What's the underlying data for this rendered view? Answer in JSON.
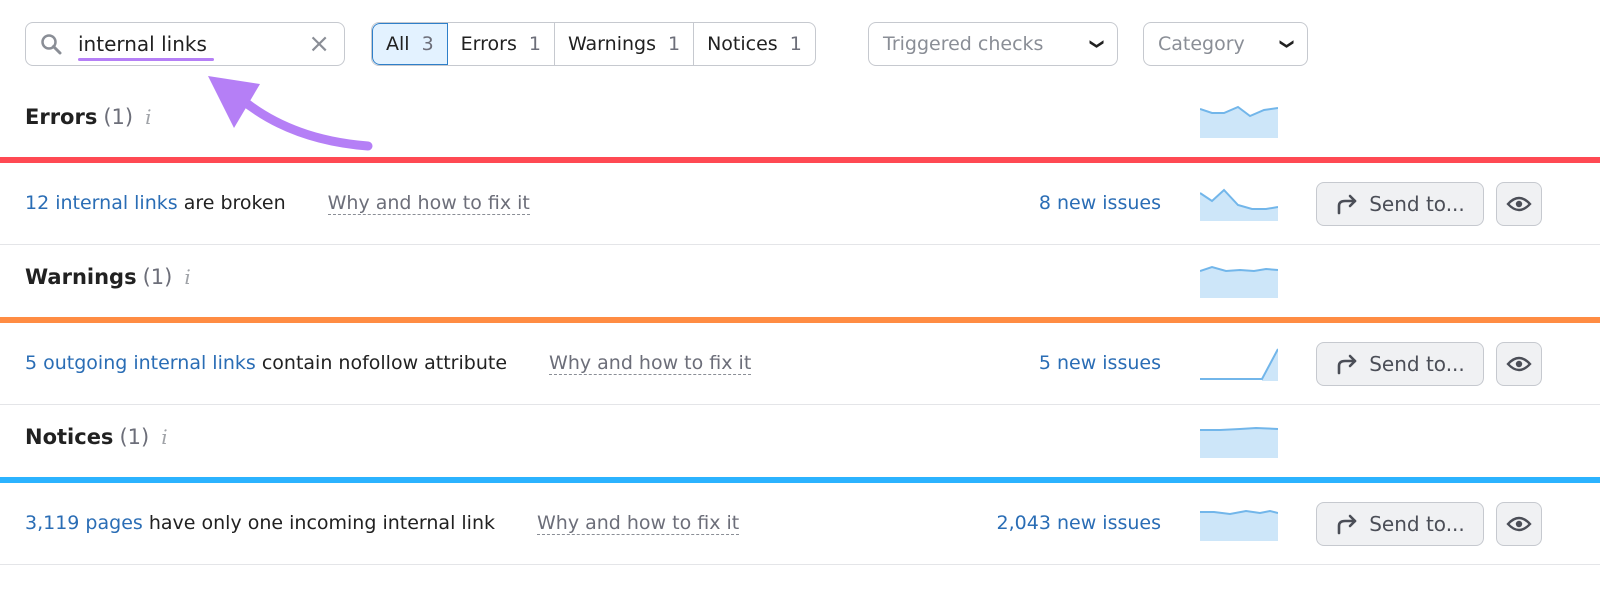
{
  "search": {
    "value": "internal links"
  },
  "filters": [
    {
      "label": "All",
      "count": "3"
    },
    {
      "label": "Errors",
      "count": "1"
    },
    {
      "label": "Warnings",
      "count": "1"
    },
    {
      "label": "Notices",
      "count": "1"
    }
  ],
  "dropdowns": {
    "triggered": "Triggered checks",
    "category": "Category"
  },
  "colors": {
    "errors": "#ff4953",
    "warnings": "#ff8c43",
    "notices": "#2bb3ff",
    "link": "#2a6db5",
    "annotation_arrow": "#b57ff6"
  },
  "sections": [
    {
      "title": "Errors",
      "count": "(1)",
      "issue": {
        "link": "12 internal links",
        "text": " are broken",
        "why": "Why and how to fix it",
        "new": "8 new issues"
      }
    },
    {
      "title": "Warnings",
      "count": "(1)",
      "issue": {
        "link": "5 outgoing internal links",
        "text": " contain nofollow attribute",
        "why": "Why and how to fix it",
        "new": "5 new issues"
      }
    },
    {
      "title": "Notices",
      "count": "(1)",
      "issue": {
        "link": "3,119 pages",
        "text": " have only one incoming internal link",
        "why": "Why and how to fix it",
        "new": "2,043 new issues"
      }
    }
  ],
  "send_label": "Send to...",
  "info_glyph": "i"
}
